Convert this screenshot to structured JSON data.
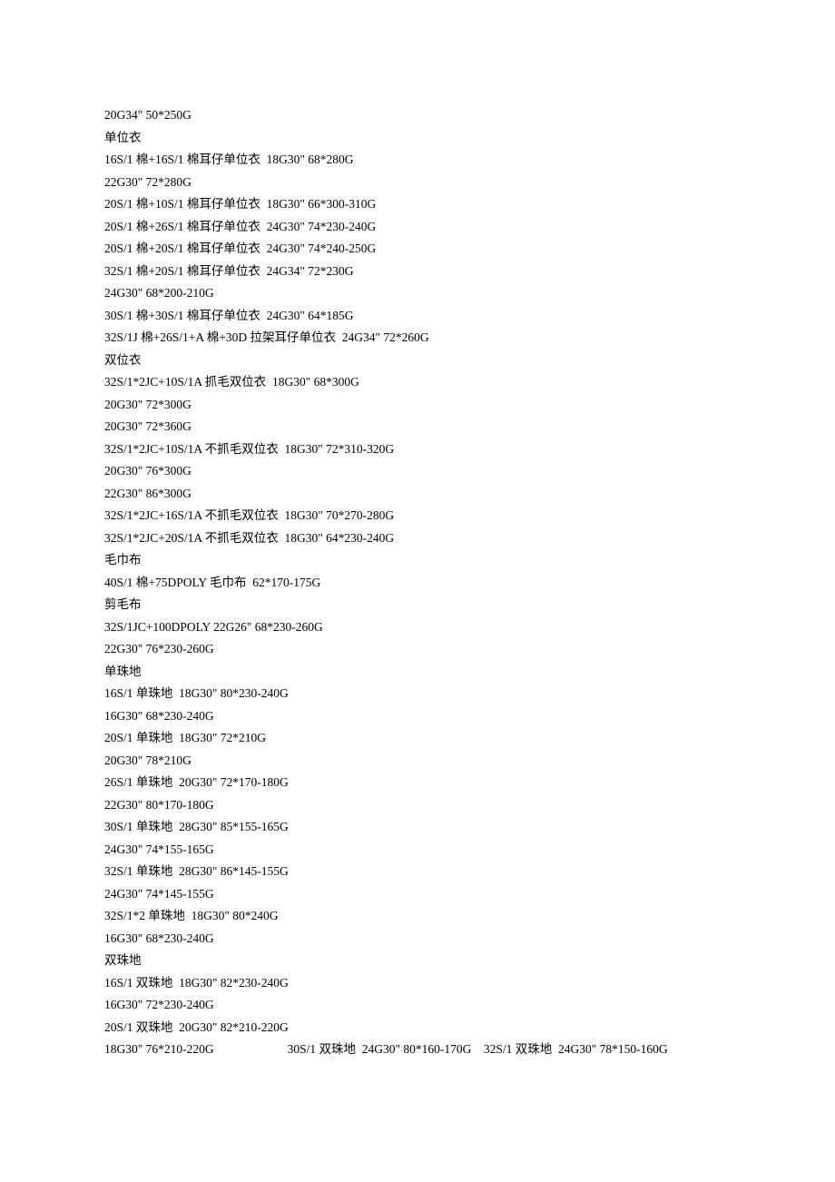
{
  "lines": [
    "20G34\" 50*250G",
    "单位衣",
    "16S/1 棉+16S/1 棉耳仔单位衣  18G30\" 68*280G",
    "22G30\" 72*280G",
    "20S/1 棉+10S/1 棉耳仔单位衣  18G30\" 66*300-310G",
    "20S/1 棉+26S/1 棉耳仔单位衣  24G30\" 74*230-240G",
    "20S/1 棉+20S/1 棉耳仔单位衣  24G30\" 74*240-250G",
    "32S/1 棉+20S/1 棉耳仔单位衣  24G34\" 72*230G",
    "24G30\" 68*200-210G",
    "30S/1 棉+30S/1 棉耳仔单位衣  24G30\" 64*185G",
    "32S/1J 棉+26S/1+A 棉+30D 拉架耳仔单位衣  24G34\" 72*260G",
    "双位衣",
    "32S/1*2JC+10S/1A 抓毛双位衣  18G30\" 68*300G",
    "20G30\" 72*300G",
    "20G30\" 72*360G",
    "32S/1*2JC+10S/1A 不抓毛双位衣  18G30\" 72*310-320G",
    "20G30\" 76*300G",
    "22G30\" 86*300G",
    "32S/1*2JC+16S/1A 不抓毛双位衣  18G30\" 70*270-280G",
    "32S/1*2JC+20S/1A 不抓毛双位衣  18G30\" 64*230-240G",
    "毛巾布",
    "40S/1 棉+75DPOLY 毛巾布  62*170-175G",
    "剪毛布",
    "32S/1JC+100DPOLY 22G26\" 68*230-260G",
    "22G30\" 76*230-260G",
    "单珠地",
    "16S/1 单珠地  18G30\" 80*230-240G",
    "16G30\" 68*230-240G",
    "20S/1 单珠地  18G30\" 72*210G",
    "20G30\" 78*210G",
    "26S/1 单珠地  20G30\" 72*170-180G",
    "22G30\" 80*170-180G",
    "30S/1 单珠地  28G30\" 85*155-165G",
    "24G30\" 74*155-165G",
    "32S/1 单珠地  28G30\" 86*145-155G",
    "24G30\" 74*145-155G",
    "32S/1*2 单珠地  18G30\" 80*240G",
    "16G30\" 68*230-240G",
    "双珠地",
    "16S/1 双珠地  18G30\" 82*230-240G",
    "16G30\" 72*230-240G",
    "20S/1 双珠地  20G30\" 82*210-220G",
    "18G30\" 76*210-220G                        30S/1 双珠地  24G30\" 80*160-170G    32S/1 双珠地  24G30\" 78*150-160G"
  ]
}
